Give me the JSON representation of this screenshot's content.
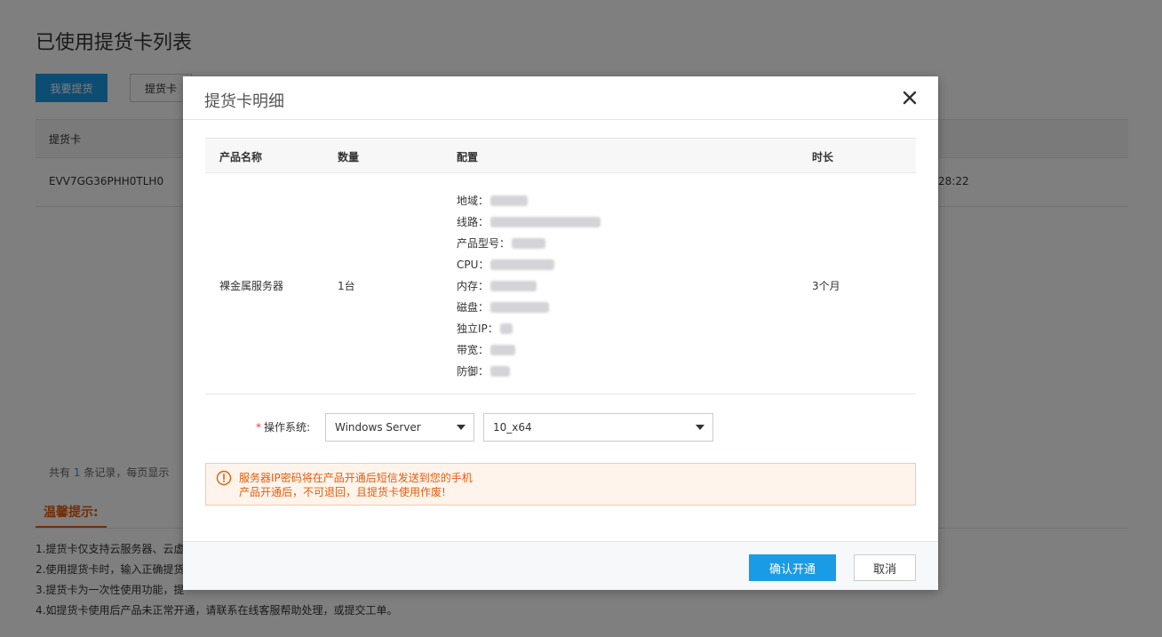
{
  "background": {
    "page_title": "已使用提货卡列表",
    "btn_pickup": "我要提货",
    "btn_card": "提货卡",
    "table_header_card": "提货卡",
    "row_card_code": "EVV7GG36PHH0TLH0",
    "row_time_fragment": "28:22",
    "records_prefix": "共有",
    "records_count": "1",
    "records_suffix": "条记录，每页显示",
    "tips_title": "温馨提示:",
    "tips": [
      "1.提货卡仅支持云服务器、云虚",
      "2.使用提货卡时，输入正确提货",
      "3.提货卡为一次性使用功能，提",
      "4.如提货卡使用后产品未正常开通，请联系在线客服帮助处理，或提交工单。"
    ]
  },
  "modal": {
    "title": "提货卡明细",
    "table": {
      "headers": [
        "产品名称",
        "数量",
        "配置",
        "时长"
      ],
      "row": {
        "product_name": "裸金属服务器",
        "quantity": "1台",
        "duration": "3个月",
        "config": [
          {
            "label": "地域："
          },
          {
            "label": "线路："
          },
          {
            "label": "产品型号："
          },
          {
            "label": "CPU："
          },
          {
            "label": "内存："
          },
          {
            "label": "磁盘："
          },
          {
            "label": "独立IP："
          },
          {
            "label": "带宽："
          },
          {
            "label": "防御："
          }
        ]
      }
    },
    "os": {
      "required_mark": "*",
      "label": "操作系统:",
      "system_value": "Windows Server",
      "version_value": "10_x64"
    },
    "alert": {
      "line1": "服务器IP密码将在产品开通后短信发送到您的手机",
      "line2": "产品开通后，不可退回，且提货卡使用作废!"
    },
    "footer": {
      "confirm_label": "确认开通",
      "cancel_label": "取消"
    }
  },
  "colors": {
    "primary": "#1a9be6",
    "warning": "#e45c0c",
    "alert_bg": "#fff4ec"
  }
}
